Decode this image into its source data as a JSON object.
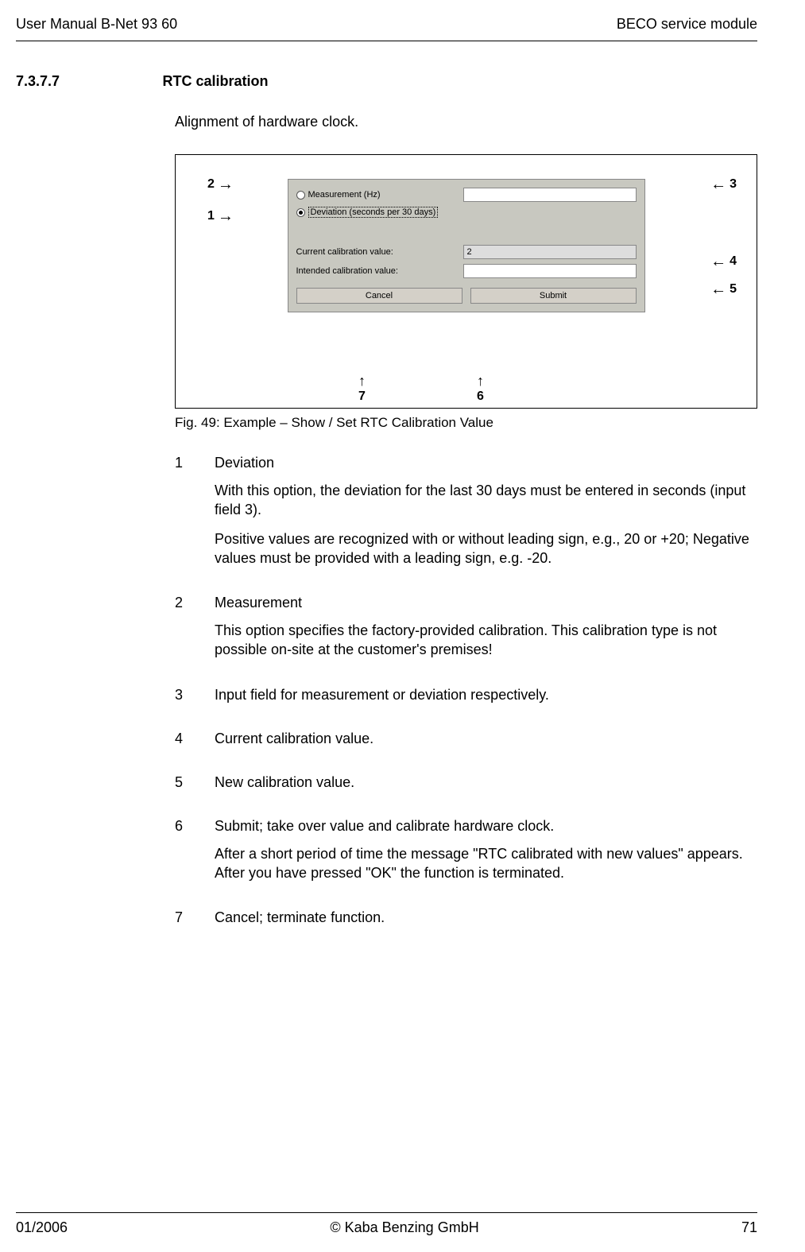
{
  "header": {
    "left": "User Manual B-Net 93 60",
    "right": "BECO service module"
  },
  "section": {
    "num": "7.3.7.7",
    "title": "RTC calibration"
  },
  "intro": "Alignment of hardware clock.",
  "dialog": {
    "opt_measurement": "Measurement (Hz)",
    "opt_deviation": "Deviation (seconds per 30 days)",
    "lbl_current": "Current calibration value:",
    "val_current": "2",
    "lbl_intended": "Intended calibration value:",
    "btn_cancel": "Cancel",
    "btn_submit": "Submit"
  },
  "annotations": {
    "n1": "1",
    "n2": "2",
    "n3": "3",
    "n4": "4",
    "n5": "5",
    "n6": "6",
    "n7": "7"
  },
  "caption": "Fig. 49: Example – Show / Set RTC Calibration Value",
  "items": [
    {
      "num": "1",
      "title": "Deviation",
      "paras": [
        "With this option, the deviation for the last 30 days must be entered in seconds (input field 3).",
        "Positive values are recognized with or without leading sign, e.g., 20 or +20; Negative values must be provided with a leading sign, e.g. -20."
      ]
    },
    {
      "num": "2",
      "title": "Measurement",
      "paras": [
        "This option specifies the factory-provided calibration.\nThis calibration type is not possible on-site at the customer's premises!"
      ]
    },
    {
      "num": "3",
      "title": "Input field for measurement or deviation respectively.",
      "paras": []
    },
    {
      "num": "4",
      "title": "Current calibration value.",
      "paras": []
    },
    {
      "num": "5",
      "title": "New calibration value.",
      "paras": []
    },
    {
      "num": "6",
      "title": "Submit; take over value and calibrate hardware clock.",
      "paras": [
        "After a short period of time the message \"RTC calibrated with new values\" appears. After you have pressed \"OK\" the function is terminated."
      ]
    },
    {
      "num": "7",
      "title": "Cancel; terminate function.",
      "paras": []
    }
  ],
  "footer": {
    "left": "01/2006",
    "center": "© Kaba Benzing GmbH",
    "right": "71"
  }
}
